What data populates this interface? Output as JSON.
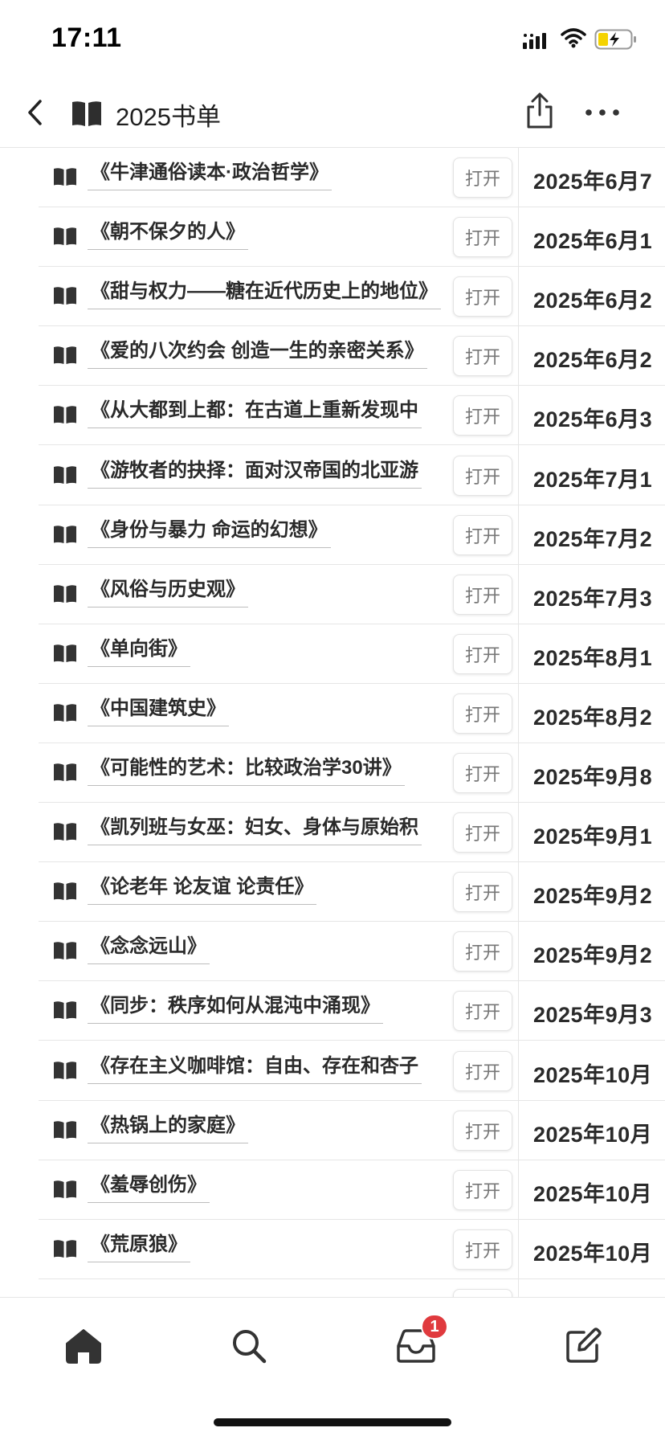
{
  "status_bar": {
    "time": "17:11"
  },
  "nav": {
    "title": "2025书单"
  },
  "table": {
    "open_label": "打开",
    "rows": [
      {
        "title": "《牛津通俗读本·政治哲学》",
        "date": "2025年6月7"
      },
      {
        "title": "《朝不保夕的人》",
        "date": "2025年6月1"
      },
      {
        "title": "《甜与权力——糖在近代历史上的地位》",
        "date": "2025年6月2"
      },
      {
        "title": "《爱的八次约会 创造一生的亲密关系》",
        "date": "2025年6月2"
      },
      {
        "title": "《从大都到上都：在古道上重新发现中",
        "date": "2025年6月3"
      },
      {
        "title": "《游牧者的抉择：面对汉帝国的北亚游",
        "date": "2025年7月1"
      },
      {
        "title": "《身份与暴力 命运的幻想》",
        "date": "2025年7月2"
      },
      {
        "title": "《风俗与历史观》",
        "date": "2025年7月3"
      },
      {
        "title": "《单向街》",
        "date": "2025年8月1"
      },
      {
        "title": "《中国建筑史》",
        "date": "2025年8月2"
      },
      {
        "title": "《可能性的艺术：比较政治学30讲》",
        "date": "2025年9月8"
      },
      {
        "title": "《凯列班与女巫：妇女、身体与原始积",
        "date": "2025年9月1"
      },
      {
        "title": "《论老年 论友谊 论责任》",
        "date": "2025年9月2"
      },
      {
        "title": "《念念远山》",
        "date": "2025年9月2"
      },
      {
        "title": "《同步：秩序如何从混沌中涌现》",
        "date": "2025年9月3"
      },
      {
        "title": "《存在主义咖啡馆：自由、存在和杏子",
        "date": "2025年10月"
      },
      {
        "title": "《热锅上的家庭》",
        "date": "2025年10月"
      },
      {
        "title": "《羞辱创伤》",
        "date": "2025年10月"
      },
      {
        "title": "《荒原狼》",
        "date": "2025年10月"
      }
    ]
  },
  "tab_bar": {
    "tabs": [
      {
        "icon": "home-icon"
      },
      {
        "icon": "search-icon"
      },
      {
        "icon": "inbox-icon"
      },
      {
        "icon": "compose-icon"
      }
    ],
    "inbox_badge": "1"
  }
}
